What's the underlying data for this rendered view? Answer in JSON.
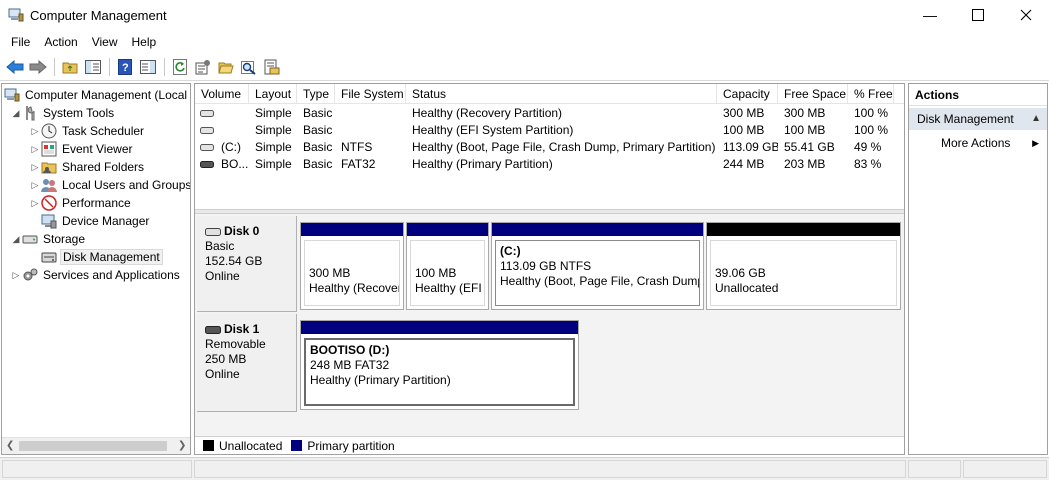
{
  "window": {
    "title": "Computer Management",
    "minimize_glyph": "—",
    "maximize_glyph": "☐",
    "close_glyph": "✕"
  },
  "menu": [
    "File",
    "Action",
    "View",
    "Help"
  ],
  "tree": {
    "items": [
      {
        "label": "Computer Management (Local",
        "icon": "computer-management-icon",
        "expander": "◢"
      },
      {
        "label": "System Tools",
        "icon": "system-tools-icon",
        "expander": "◢"
      },
      {
        "label": "Task Scheduler",
        "icon": "clock-icon",
        "expander": "▷"
      },
      {
        "label": "Event Viewer",
        "icon": "event-viewer-icon",
        "expander": "▷"
      },
      {
        "label": "Shared Folders",
        "icon": "shared-folder-icon",
        "expander": "▷"
      },
      {
        "label": "Local Users and Groups",
        "icon": "users-icon",
        "expander": "▷"
      },
      {
        "label": "Performance",
        "icon": "performance-icon",
        "expander": "▷"
      },
      {
        "label": "Device Manager",
        "icon": "device-manager-icon",
        "expander": ""
      },
      {
        "label": "Storage",
        "icon": "storage-icon",
        "expander": "◢"
      },
      {
        "label": "Disk Management",
        "icon": "disk-management-icon",
        "expander": ""
      },
      {
        "label": "Services and Applications",
        "icon": "services-icon",
        "expander": "▷"
      }
    ],
    "scroll_left": "❮",
    "scroll_right": "❯"
  },
  "volumes": {
    "columns": [
      "Volume",
      "Layout",
      "Type",
      "File System",
      "Status",
      "Capacity",
      "Free Space",
      "% Free"
    ],
    "rows": [
      {
        "volume": "",
        "layout": "Simple",
        "type": "Basic",
        "fs": "",
        "status": "Healthy (Recovery Partition)",
        "capacity": "300 MB",
        "free": "300 MB",
        "pct": "100 %"
      },
      {
        "volume": "",
        "layout": "Simple",
        "type": "Basic",
        "fs": "",
        "status": "Healthy (EFI System Partition)",
        "capacity": "100 MB",
        "free": "100 MB",
        "pct": "100 %"
      },
      {
        "volume": "(C:)",
        "layout": "Simple",
        "type": "Basic",
        "fs": "NTFS",
        "status": "Healthy (Boot, Page File, Crash Dump, Primary Partition)",
        "capacity": "113.09 GB",
        "free": "55.41 GB",
        "pct": "49 %"
      },
      {
        "volume": "BO...",
        "layout": "Simple",
        "type": "Basic",
        "fs": "FAT32",
        "status": "Healthy (Primary Partition)",
        "capacity": "244 MB",
        "free": "203 MB",
        "pct": "83 %"
      }
    ]
  },
  "disks": [
    {
      "name": "Disk 0",
      "kind": "Basic",
      "size": "152.54 GB",
      "state": "Online",
      "partitions": [
        {
          "title": "",
          "line1": "300 MB",
          "line2": "Healthy (Recover",
          "color": "#00007f"
        },
        {
          "title": "",
          "line1": "100 MB",
          "line2": "Healthy (EFI S",
          "color": "#00007f"
        },
        {
          "title": "(C:)",
          "line1": "113.09 GB NTFS",
          "line2": "Healthy (Boot, Page File, Crash Dump,",
          "color": "#00007f"
        },
        {
          "title": "",
          "line1": "39.06 GB",
          "line2": "Unallocated",
          "color": "#000000"
        }
      ]
    },
    {
      "name": "Disk 1",
      "kind": "Removable",
      "size": "250 MB",
      "state": "Online",
      "partitions": [
        {
          "title": "BOOTISO  (D:)",
          "line1": "248 MB FAT32",
          "line2": "Healthy (Primary Partition)",
          "color": "#00007f"
        }
      ]
    }
  ],
  "legend": [
    {
      "label": "Unallocated",
      "color": "#000000"
    },
    {
      "label": "Primary partition",
      "color": "#00007f"
    }
  ],
  "actions": {
    "header": "Actions",
    "section": "Disk Management",
    "section_arrow": "▲",
    "item": "More Actions",
    "item_arrow": "▶"
  }
}
